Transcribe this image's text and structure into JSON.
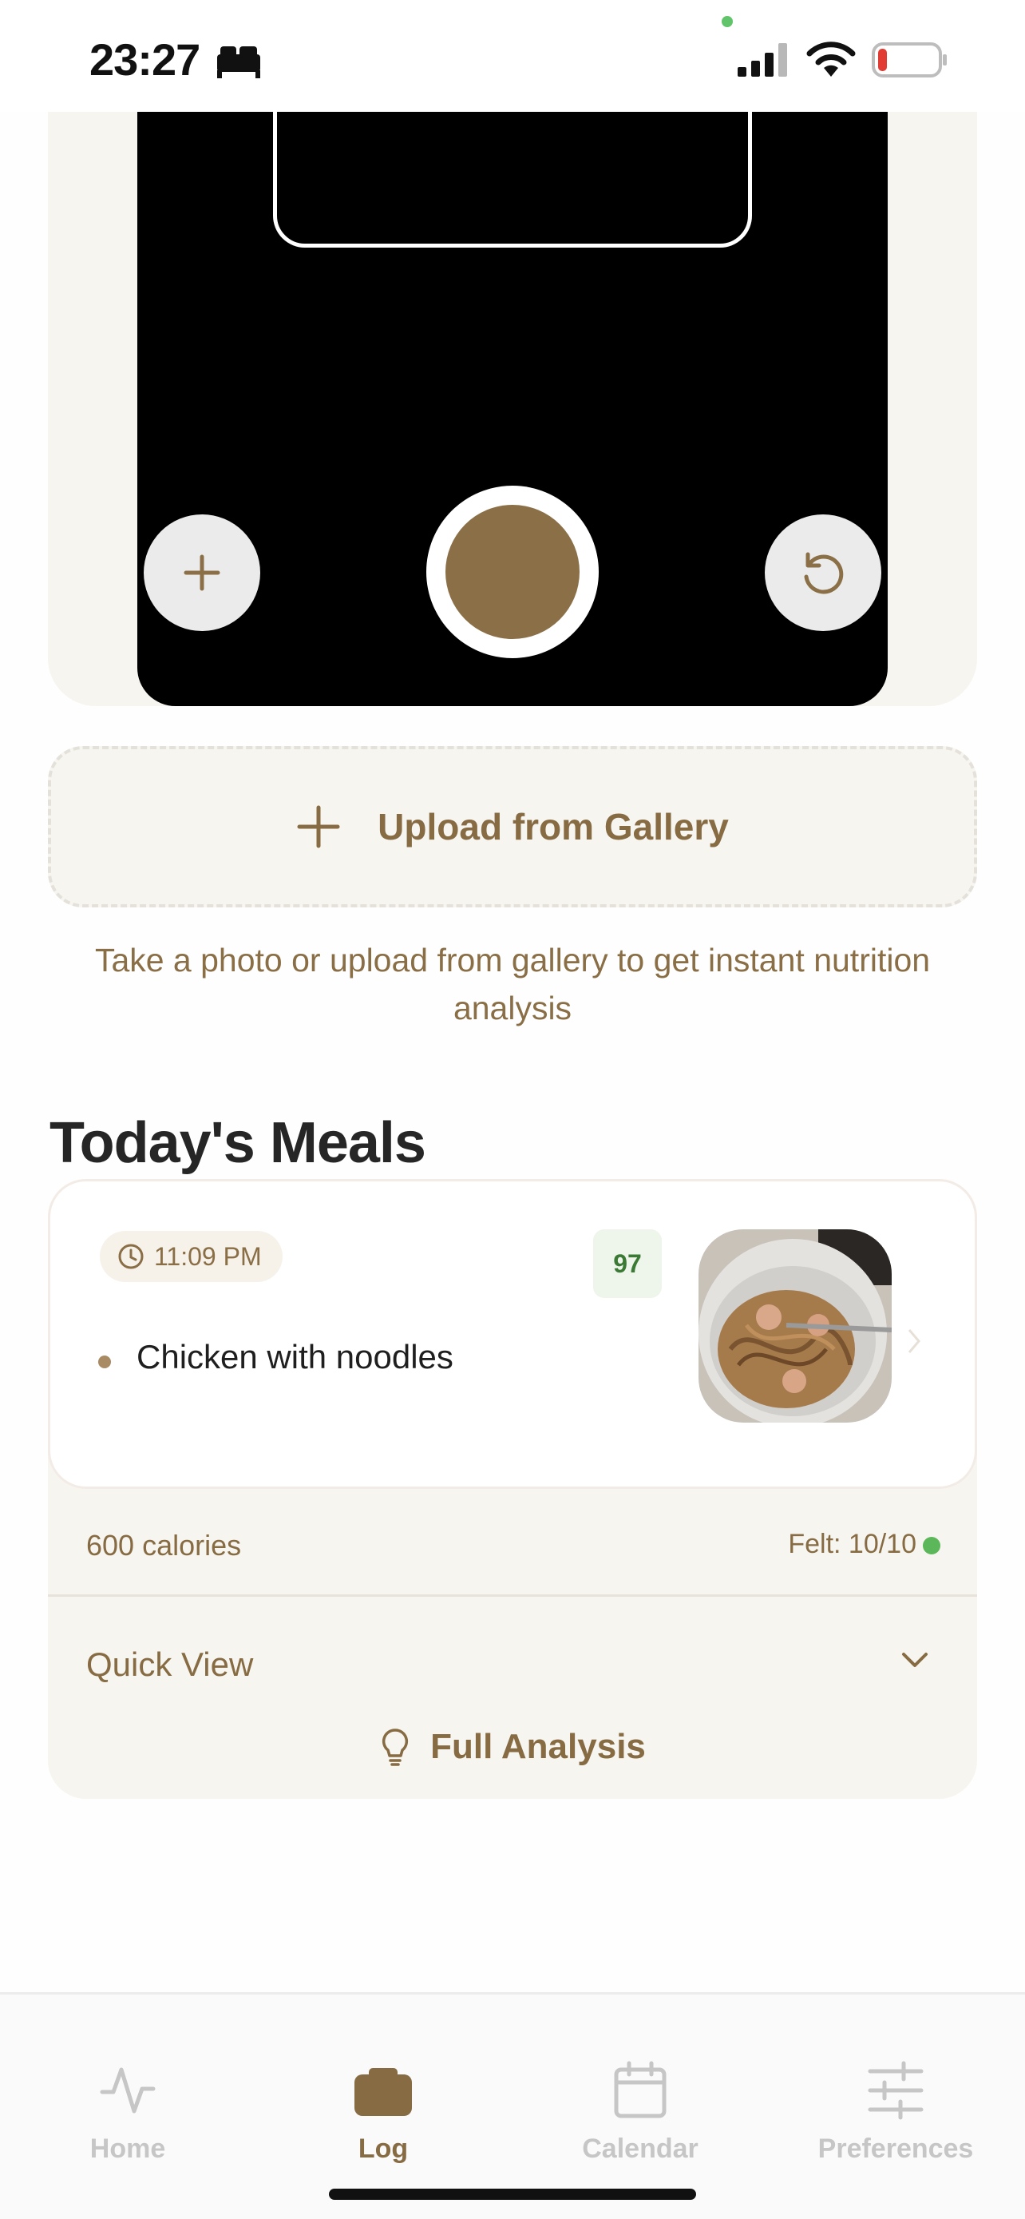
{
  "status_bar": {
    "time": "23:27",
    "icons": [
      "bed-icon",
      "signal-icon",
      "wifi-icon",
      "battery-icon"
    ],
    "battery_level": 0.15,
    "battery_color": "#e23b33"
  },
  "camera": {
    "left_button_icon": "plus-icon",
    "right_button_icon": "rotate-icon",
    "shutter_color": "#8b6f47"
  },
  "upload": {
    "label": "Upload from Gallery",
    "icon": "plus-icon"
  },
  "helper_text": "Take a photo or upload from gallery to get instant nutrition analysis",
  "section_title": "Today's Meals",
  "meal": {
    "time": "11:09 PM",
    "score": "97",
    "items": [
      "Chicken with noodles"
    ],
    "calories": "600 calories",
    "felt": "Felt: 10/10",
    "felt_color": "#5cb75a",
    "quick_view_label": "Quick View",
    "full_analysis_label": "Full Analysis"
  },
  "tabs": [
    {
      "label": "Home",
      "icon": "activity-icon",
      "active": false
    },
    {
      "label": "Log",
      "icon": "camera-icon",
      "active": true
    },
    {
      "label": "Calendar",
      "icon": "calendar-icon",
      "active": false
    },
    {
      "label": "Preferences",
      "icon": "sliders-icon",
      "active": false
    }
  ],
  "colors": {
    "accent": "#866b43",
    "card_background": "#f7f5f0",
    "inactive_tab": "#c6c6c6"
  }
}
